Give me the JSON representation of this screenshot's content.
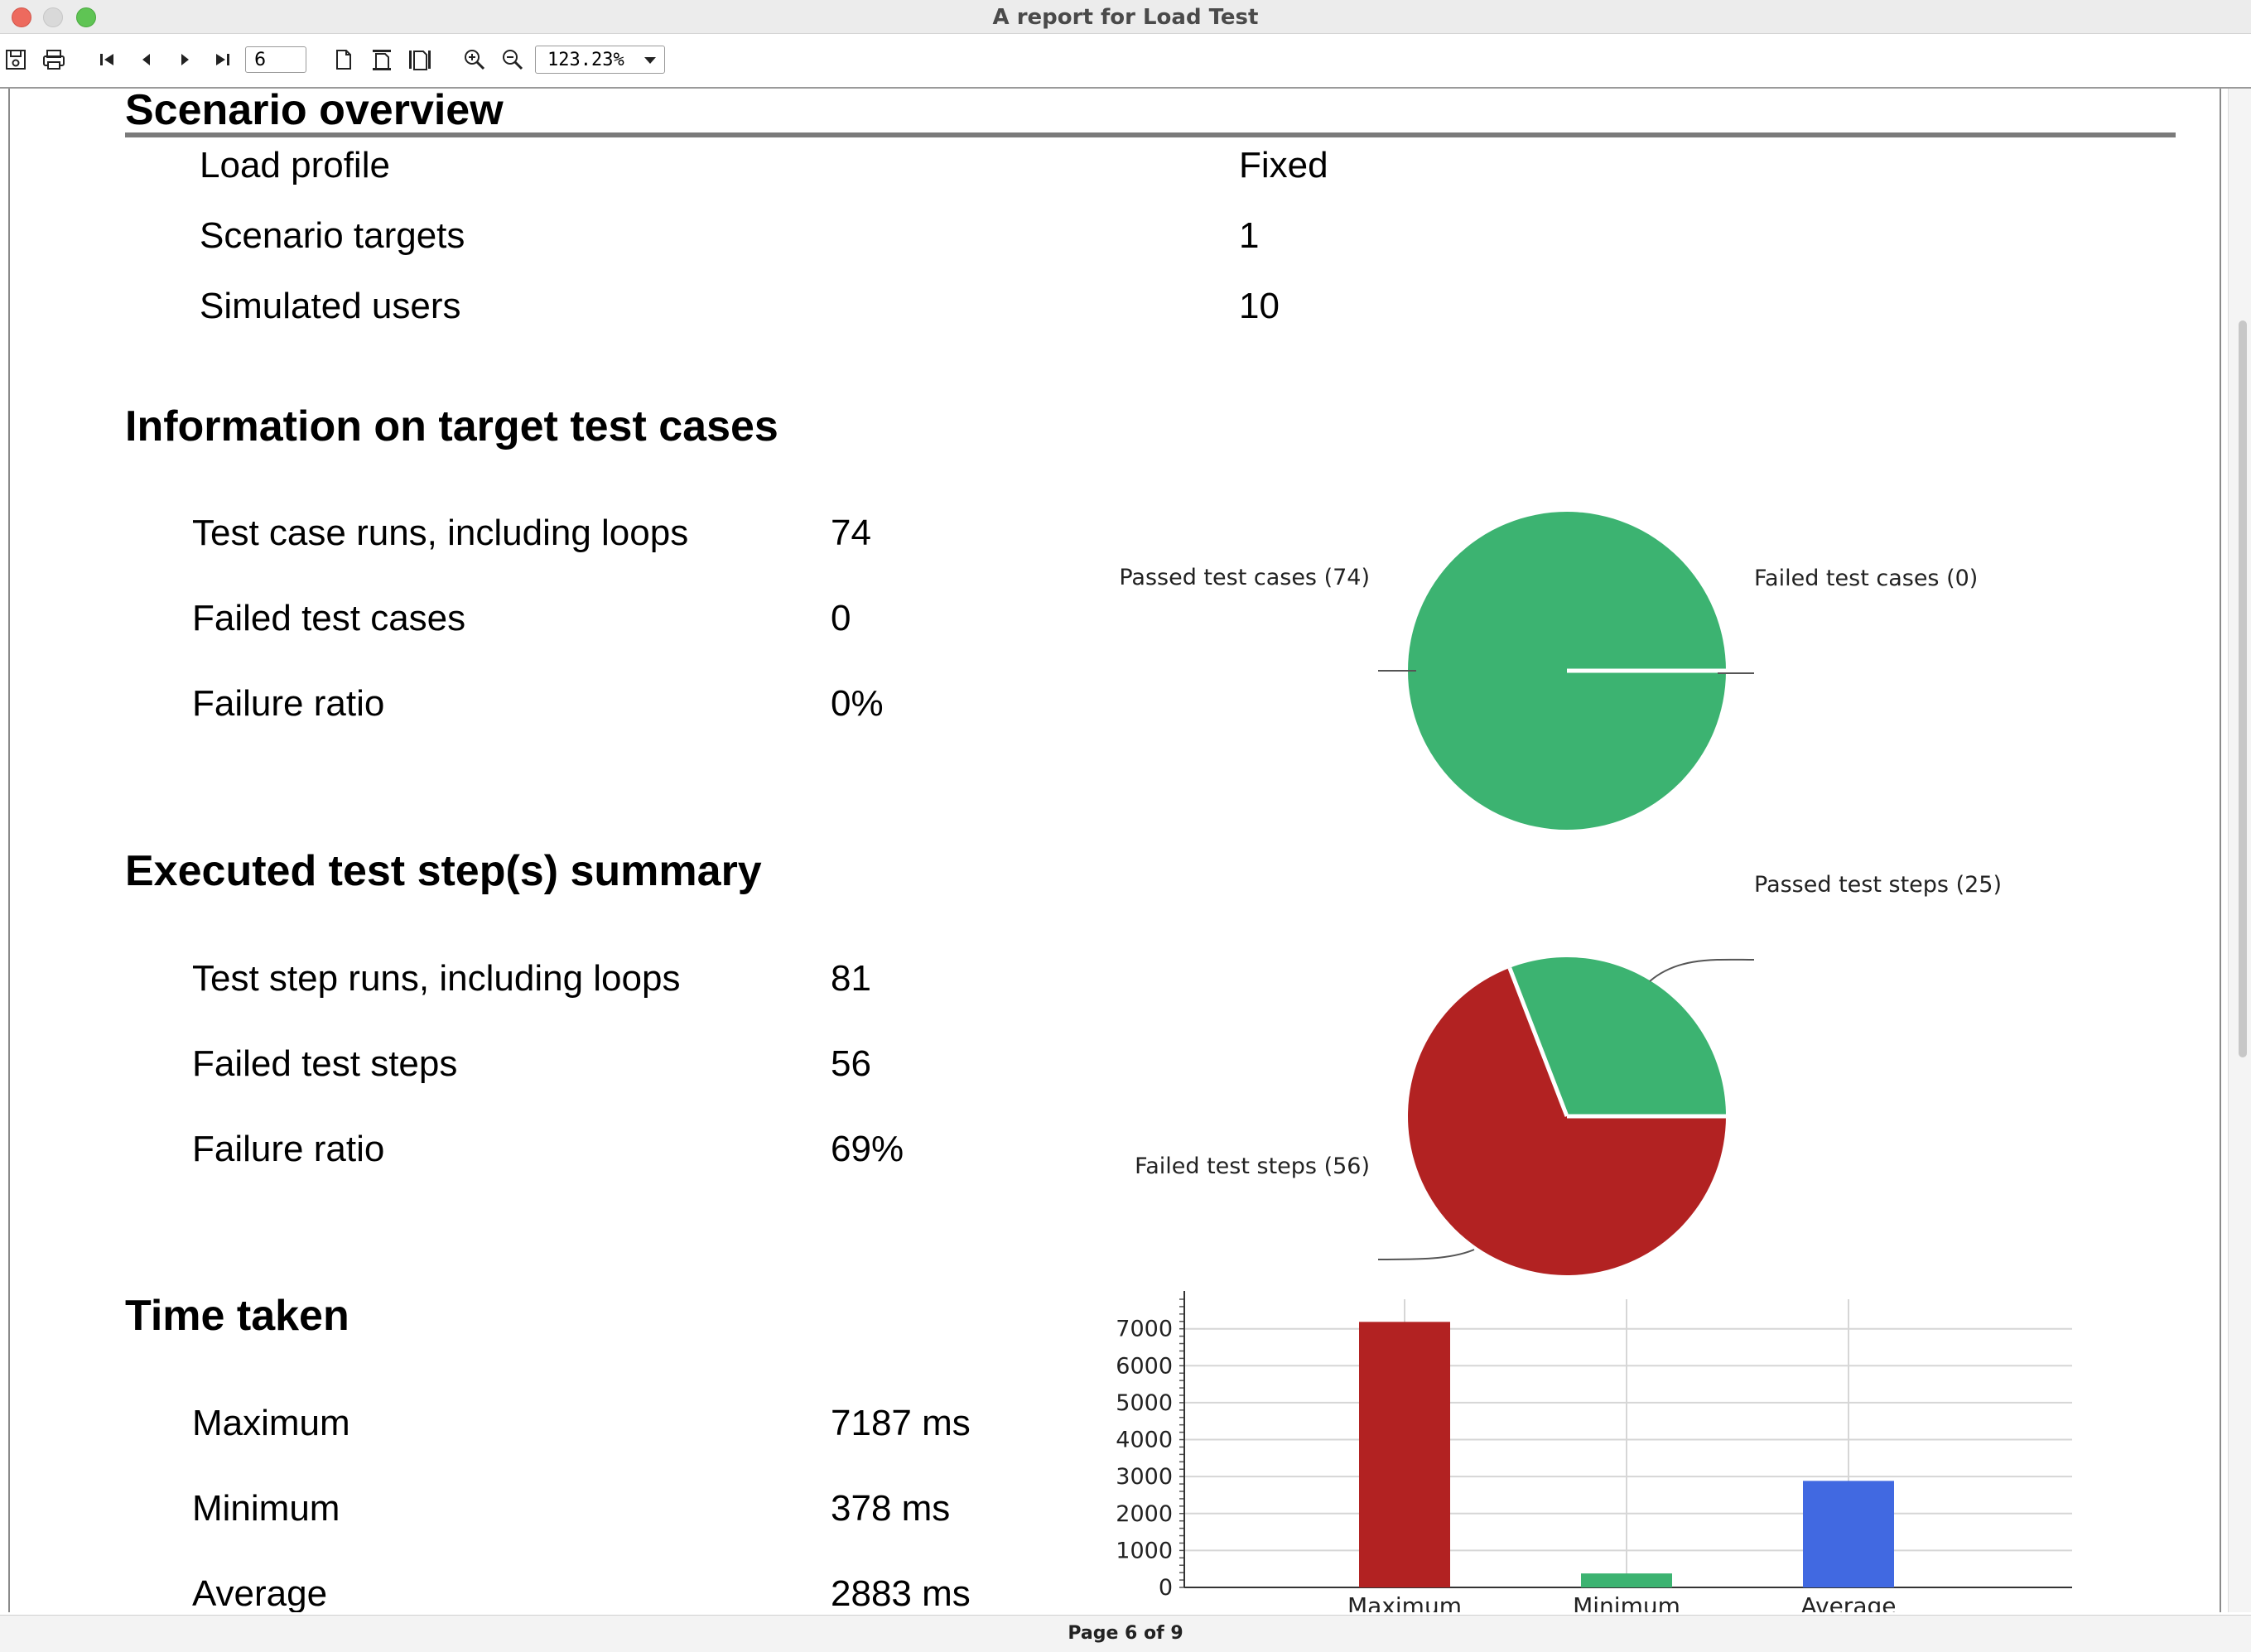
{
  "window": {
    "title": "A report for Load Test"
  },
  "toolbar": {
    "page_number": "6",
    "zoom": "123.23%"
  },
  "scenario_overview": {
    "title": "Scenario overview",
    "rows": [
      {
        "label": "Load profile",
        "value": "Fixed"
      },
      {
        "label": "Scenario targets",
        "value": "1"
      },
      {
        "label": "Simulated users",
        "value": "10"
      }
    ]
  },
  "target_cases": {
    "title": "Information on target test cases",
    "rows": [
      {
        "label": "Test case runs, including loops",
        "value": "74"
      },
      {
        "label": "Failed test cases",
        "value": "0"
      },
      {
        "label": "Failure ratio",
        "value": "0%"
      }
    ]
  },
  "test_steps": {
    "title": "Executed test step(s) summary",
    "rows": [
      {
        "label": "Test step runs, including loops",
        "value": "81"
      },
      {
        "label": "Failed test steps",
        "value": "56"
      },
      {
        "label": "Failure ratio",
        "value": "69%"
      }
    ]
  },
  "time_taken": {
    "title": "Time taken",
    "rows": [
      {
        "label": "Maximum",
        "value": "7187 ms"
      },
      {
        "label": "Minimum",
        "value": "378 ms"
      },
      {
        "label": "Average",
        "value": "2883 ms"
      }
    ]
  },
  "chart_data": [
    {
      "type": "pie",
      "labels": [
        "Passed test cases (74)",
        "Failed test cases (0)"
      ],
      "values": [
        74,
        0
      ],
      "colors": [
        "#3cb371",
        "#b22222"
      ]
    },
    {
      "type": "pie",
      "labels": [
        "Passed test steps (25)",
        "Failed test steps (56)"
      ],
      "values": [
        25,
        56
      ],
      "colors": [
        "#3cb371",
        "#b22222"
      ]
    },
    {
      "type": "bar",
      "categories": [
        "Maximum",
        "Minimum",
        "Average"
      ],
      "values": [
        7187,
        378,
        2883
      ],
      "colors": [
        "#b22222",
        "#3cb371",
        "#4169e1"
      ],
      "ylim": [
        0,
        7800
      ],
      "yticks": [
        0,
        1000,
        2000,
        3000,
        4000,
        5000,
        6000,
        7000
      ],
      "grid": true
    }
  ],
  "status": {
    "page_indicator": "Page 6 of 9"
  }
}
